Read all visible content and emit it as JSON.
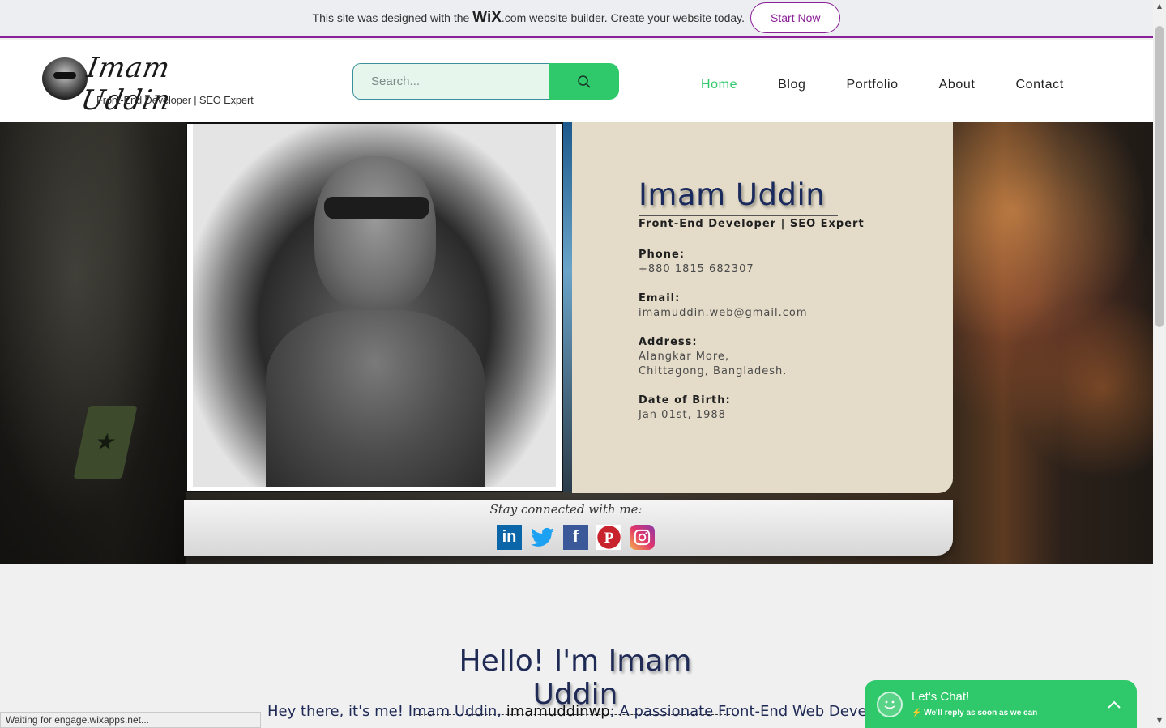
{
  "wix_banner": {
    "text_prefix": "This site was designed with the",
    "brand": "WiX",
    "brand_suffix": ".com",
    "text_suffix": "website builder. Create your website today.",
    "cta": "Start Now"
  },
  "header": {
    "logo_signature": "Imam Uddin",
    "logo_subtitle": "Front-End Developer | SEO Expert",
    "search_placeholder": "Search...",
    "nav": [
      "Home",
      "Blog",
      "Portfolio",
      "About",
      "Contact"
    ],
    "active_nav": "Home"
  },
  "profile": {
    "name": "Imam Uddin",
    "title": "Front-End Developer | SEO Expert",
    "phone_label": "Phone:",
    "phone": "+880 1815 682307",
    "email_label": "Email:",
    "email": "imamuddin.web@gmail.com",
    "address_label": "Address:",
    "address_line1": "Alangkar More,",
    "address_line2": "Chittagong, Bangladesh.",
    "dob_label": "Date of Birth:",
    "dob": "Jan 01st, 1988"
  },
  "social": {
    "label": "Stay connected with me:",
    "icons": [
      "linkedin-icon",
      "twitter-icon",
      "facebook-icon",
      "pinterest-icon",
      "instagram-icon"
    ]
  },
  "intro": {
    "hello_prefix": "Hello! I'm",
    "hello_name": "Imam Uddin",
    "text_prefix": "Hey there, it's me! Imam Uddin,",
    "handle": "imamuddinwp",
    "text_suffix": "; A passionate Front-End Web Developer & SEO Expert"
  },
  "status_bar": "Waiting for engage.wixapps.net...",
  "chat": {
    "title": "Let's Chat!",
    "subtitle": "We'll reply as soon as we can"
  },
  "colors": {
    "accent_green": "#2fc86a",
    "wix_purple": "#8a1f97",
    "name_navy": "#1a2a5c",
    "card_beige": "#e4dcc9"
  }
}
